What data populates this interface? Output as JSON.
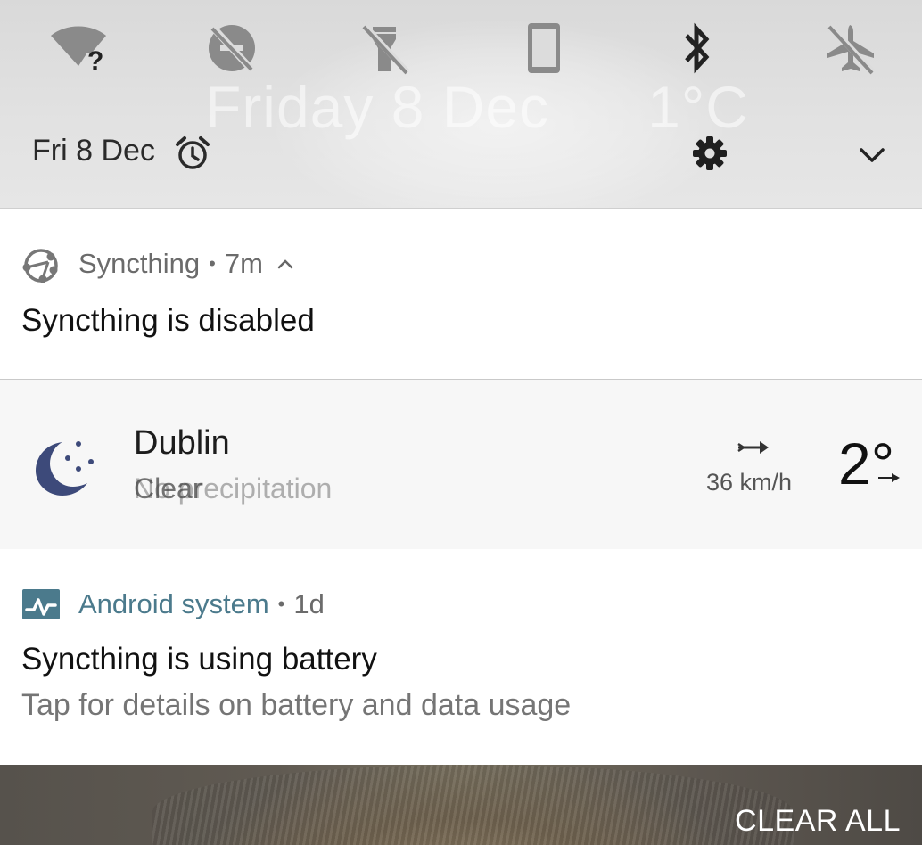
{
  "quick_settings": {
    "tiles": [
      {
        "name": "wifi-unknown-icon",
        "state": "off"
      },
      {
        "name": "do-not-disturb-off-icon",
        "state": "off"
      },
      {
        "name": "flashlight-off-icon",
        "state": "off"
      },
      {
        "name": "auto-rotate-icon",
        "state": "off"
      },
      {
        "name": "bluetooth-icon",
        "state": "on"
      },
      {
        "name": "airplane-mode-off-icon",
        "state": "off"
      }
    ],
    "date": "Fri 8 Dec",
    "watermark_date": "Friday 8 Dec",
    "watermark_temp": "1°C"
  },
  "notifications": {
    "syncthing": {
      "app": "Syncthing",
      "time": "7m",
      "title": "Syncthing is disabled"
    },
    "weather": {
      "city": "Dublin",
      "condition": "Clear",
      "condition_overlay": "No precipitation",
      "wind": "36 km/h",
      "temp": "2°"
    },
    "android": {
      "app": "Android system",
      "time": "1d",
      "title": "Syncthing is using battery",
      "body": "Tap for details on battery and data usage"
    }
  },
  "footer": {
    "clear_all": "CLEAR ALL"
  },
  "colors": {
    "qs_background": "#dcdcdc",
    "active_icon": "#222222",
    "inactive_icon": "#8a8a8a",
    "android_accent": "#4b7a8c",
    "moon": "#3d4a7a"
  }
}
